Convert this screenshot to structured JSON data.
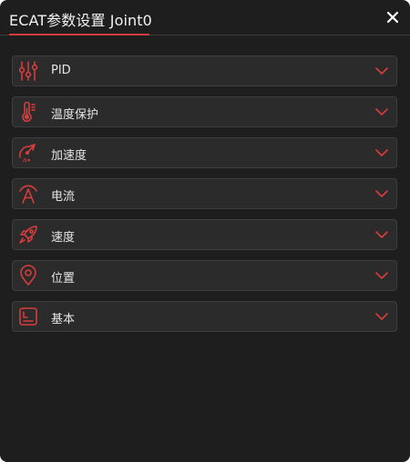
{
  "window": {
    "title": "ECAT参数设置 Joint0"
  },
  "accent_color": "#d83c3c",
  "sections": [
    {
      "label": "PID",
      "icon": "sliders-icon"
    },
    {
      "label": "温度保护",
      "icon": "thermometer-icon"
    },
    {
      "label": "加速度",
      "icon": "acceleration-icon"
    },
    {
      "label": "电流",
      "icon": "current-icon"
    },
    {
      "label": "速度",
      "icon": "rocket-icon"
    },
    {
      "label": "位置",
      "icon": "location-pin-icon"
    },
    {
      "label": "基本",
      "icon": "basic-card-icon"
    }
  ]
}
